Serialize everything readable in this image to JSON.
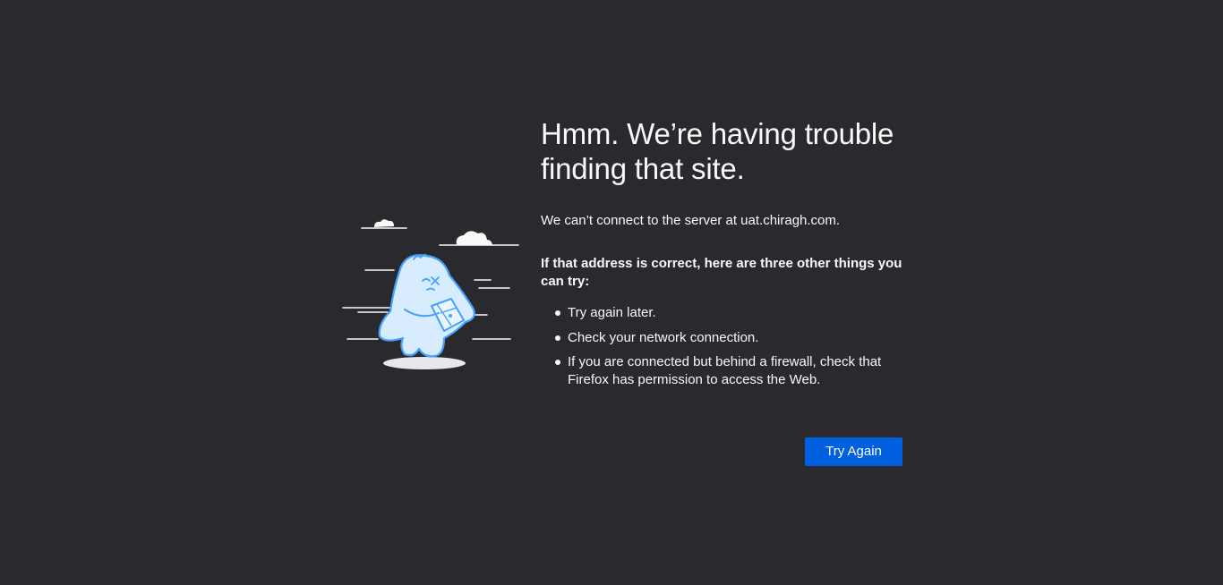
{
  "error": {
    "title": "Hmm. We’re having trouble finding that site.",
    "description": "We can’t connect to the server at uat.chiragh.com.",
    "hint_title": "If that address is correct, here are three other things you can try:",
    "tips": [
      "Try again later.",
      "Check your network connection.",
      "If you are connected but behind a firewall, check that Firefox has permission to access the Web."
    ],
    "button_label": "Try Again"
  },
  "colors": {
    "background": "#2a2a2e",
    "text": "#f9f9fa",
    "accent_button": "#0060df",
    "illustration_blue": "#45a1ff"
  },
  "icons": {
    "illustration": "lost-creature-with-map-illustration"
  }
}
